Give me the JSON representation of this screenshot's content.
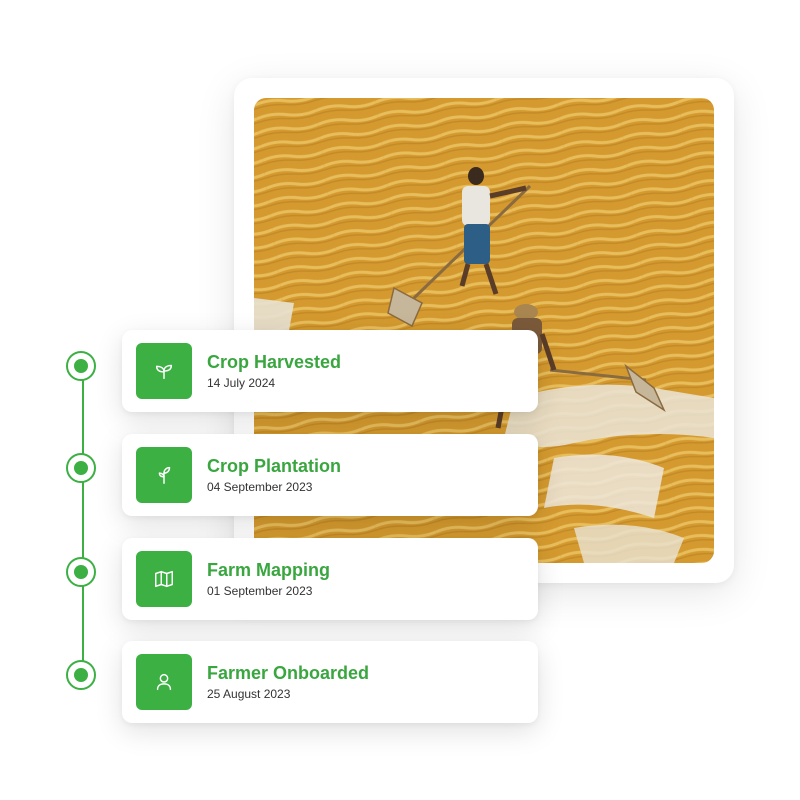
{
  "colors": {
    "accent": "#3cb043",
    "title_green": "#3aa640",
    "date_text": "#333333",
    "grain": "#d9a23a"
  },
  "timeline": {
    "events": [
      {
        "title": "Crop Harvested",
        "date": "14 July 2024",
        "icon": "sprout-leaves-icon"
      },
      {
        "title": "Crop Plantation",
        "date": "04 September 2023",
        "icon": "seedling-icon"
      },
      {
        "title": "Farm Mapping",
        "date": "01 September 2023",
        "icon": "map-icon"
      },
      {
        "title": "Farmer Onboarded",
        "date": "25 August 2023",
        "icon": "user-icon"
      }
    ]
  }
}
